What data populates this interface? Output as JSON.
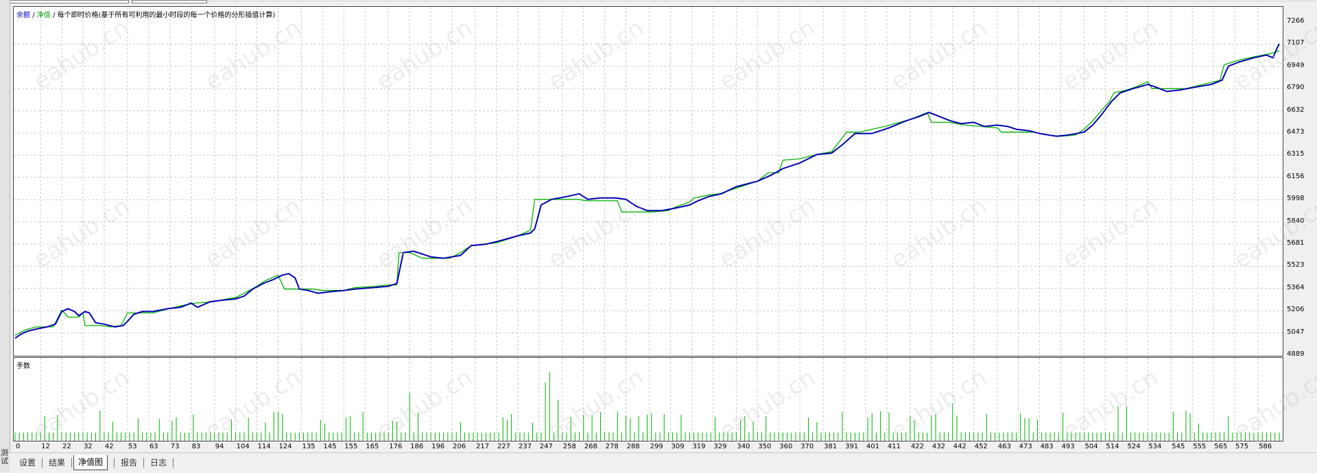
{
  "chart": {
    "legend": {
      "balance": "余额",
      "equity": "净值",
      "sep": "/",
      "note": "每个即时价格(基于所有可利用的最小时段的每一个价格的分形插值计算)"
    },
    "volume_label": "手数",
    "colors": {
      "balance": "#00b000",
      "equity": "#0000b0",
      "volume": "#00b000",
      "grid": "#c8c8c8"
    }
  },
  "sidebar": {
    "label": "测试"
  },
  "tabs": [
    {
      "label": "设置",
      "active": false
    },
    {
      "label": "结果",
      "active": false
    },
    {
      "label": "净值图",
      "active": true
    },
    {
      "label": "报告",
      "active": false
    },
    {
      "label": "日志",
      "active": false
    }
  ],
  "watermark": "eahub.cn",
  "chart_data": {
    "type": "line",
    "y_ticks": [
      "7266",
      "7107",
      "6949",
      "6790",
      "6632",
      "6473",
      "6315",
      "6156",
      "5998",
      "5840",
      "5681",
      "5523",
      "5364",
      "5206",
      "5047",
      "4889"
    ],
    "x_ticks": [
      "0",
      "12",
      "22",
      "32",
      "42",
      "53",
      "63",
      "73",
      "83",
      "94",
      "104",
      "114",
      "124",
      "135",
      "145",
      "155",
      "165",
      "176",
      "186",
      "196",
      "206",
      "217",
      "227",
      "237",
      "247",
      "258",
      "268",
      "278",
      "288",
      "299",
      "309",
      "319",
      "329",
      "340",
      "350",
      "360",
      "370",
      "381",
      "391",
      "401",
      "411",
      "422",
      "432",
      "442",
      "452",
      "463",
      "473",
      "483",
      "493",
      "504",
      "514",
      "524",
      "534",
      "545",
      "555",
      "565",
      "575",
      "586"
    ],
    "ylim": [
      4889,
      7266
    ],
    "xlim": [
      0,
      596
    ],
    "series": [
      {
        "name": "余额",
        "points": [
          [
            0,
            5030
          ],
          [
            5,
            5070
          ],
          [
            10,
            5090
          ],
          [
            18,
            5090
          ],
          [
            22,
            5210
          ],
          [
            25,
            5160
          ],
          [
            30,
            5160
          ],
          [
            32,
            5190
          ],
          [
            33,
            5100
          ],
          [
            40,
            5100
          ],
          [
            45,
            5090
          ],
          [
            50,
            5100
          ],
          [
            53,
            5190
          ],
          [
            57,
            5190
          ],
          [
            65,
            5190
          ],
          [
            70,
            5210
          ],
          [
            78,
            5240
          ],
          [
            85,
            5260
          ],
          [
            94,
            5270
          ],
          [
            100,
            5290
          ],
          [
            104,
            5300
          ],
          [
            108,
            5330
          ],
          [
            114,
            5380
          ],
          [
            118,
            5420
          ],
          [
            124,
            5460
          ],
          [
            127,
            5360
          ],
          [
            135,
            5360
          ],
          [
            140,
            5360
          ],
          [
            145,
            5350
          ],
          [
            155,
            5350
          ],
          [
            160,
            5370
          ],
          [
            170,
            5380
          ],
          [
            176,
            5390
          ],
          [
            180,
            5390
          ],
          [
            181,
            5620
          ],
          [
            186,
            5620
          ],
          [
            192,
            5580
          ],
          [
            205,
            5580
          ],
          [
            210,
            5620
          ],
          [
            215,
            5670
          ],
          [
            220,
            5680
          ],
          [
            227,
            5690
          ],
          [
            237,
            5740
          ],
          [
            243,
            5780
          ],
          [
            245,
            6000
          ],
          [
            252,
            6000
          ],
          [
            260,
            6000
          ],
          [
            265,
            6000
          ],
          [
            270,
            5990
          ],
          [
            278,
            5990
          ],
          [
            284,
            5990
          ],
          [
            286,
            5910
          ],
          [
            290,
            5910
          ],
          [
            300,
            5910
          ],
          [
            308,
            5920
          ],
          [
            312,
            5950
          ],
          [
            318,
            5980
          ],
          [
            320,
            6010
          ],
          [
            327,
            6030
          ],
          [
            332,
            6040
          ],
          [
            340,
            6080
          ],
          [
            350,
            6130
          ],
          [
            355,
            6190
          ],
          [
            360,
            6190
          ],
          [
            362,
            6280
          ],
          [
            370,
            6290
          ],
          [
            378,
            6320
          ],
          [
            385,
            6340
          ],
          [
            389,
            6420
          ],
          [
            392,
            6480
          ],
          [
            398,
            6480
          ],
          [
            410,
            6520
          ],
          [
            422,
            6570
          ],
          [
            430,
            6620
          ],
          [
            432,
            6550
          ],
          [
            440,
            6550
          ],
          [
            448,
            6530
          ],
          [
            463,
            6510
          ],
          [
            465,
            6480
          ],
          [
            475,
            6480
          ],
          [
            480,
            6480
          ],
          [
            487,
            6460
          ],
          [
            493,
            6450
          ],
          [
            500,
            6460
          ],
          [
            504,
            6500
          ],
          [
            508,
            6560
          ],
          [
            512,
            6630
          ],
          [
            516,
            6700
          ],
          [
            518,
            6760
          ],
          [
            524,
            6780
          ],
          [
            528,
            6800
          ],
          [
            534,
            6840
          ],
          [
            536,
            6790
          ],
          [
            545,
            6790
          ],
          [
            552,
            6790
          ],
          [
            560,
            6820
          ],
          [
            568,
            6850
          ],
          [
            570,
            6960
          ],
          [
            576,
            6990
          ],
          [
            585,
            7020
          ],
          [
            592,
            7040
          ],
          [
            596,
            7060
          ]
        ]
      },
      {
        "name": "净值",
        "points": [
          [
            0,
            5010
          ],
          [
            3,
            5040
          ],
          [
            6,
            5060
          ],
          [
            10,
            5075
          ],
          [
            15,
            5090
          ],
          [
            19,
            5110
          ],
          [
            22,
            5200
          ],
          [
            25,
            5220
          ],
          [
            28,
            5200
          ],
          [
            30,
            5170
          ],
          [
            33,
            5200
          ],
          [
            35,
            5190
          ],
          [
            38,
            5120
          ],
          [
            42,
            5110
          ],
          [
            47,
            5090
          ],
          [
            51,
            5100
          ],
          [
            53,
            5130
          ],
          [
            56,
            5180
          ],
          [
            60,
            5200
          ],
          [
            65,
            5200
          ],
          [
            72,
            5220
          ],
          [
            78,
            5230
          ],
          [
            83,
            5260
          ],
          [
            86,
            5230
          ],
          [
            92,
            5270
          ],
          [
            97,
            5280
          ],
          [
            104,
            5290
          ],
          [
            108,
            5310
          ],
          [
            112,
            5360
          ],
          [
            117,
            5400
          ],
          [
            122,
            5430
          ],
          [
            126,
            5460
          ],
          [
            129,
            5470
          ],
          [
            132,
            5440
          ],
          [
            134,
            5360
          ],
          [
            138,
            5350
          ],
          [
            143,
            5330
          ],
          [
            148,
            5340
          ],
          [
            155,
            5350
          ],
          [
            160,
            5360
          ],
          [
            168,
            5370
          ],
          [
            176,
            5380
          ],
          [
            180,
            5400
          ],
          [
            183,
            5620
          ],
          [
            188,
            5630
          ],
          [
            192,
            5610
          ],
          [
            196,
            5590
          ],
          [
            202,
            5580
          ],
          [
            210,
            5600
          ],
          [
            215,
            5670
          ],
          [
            222,
            5680
          ],
          [
            230,
            5710
          ],
          [
            237,
            5740
          ],
          [
            243,
            5760
          ],
          [
            245,
            5790
          ],
          [
            248,
            5960
          ],
          [
            253,
            6000
          ],
          [
            260,
            6020
          ],
          [
            266,
            6040
          ],
          [
            270,
            6000
          ],
          [
            276,
            6010
          ],
          [
            283,
            6010
          ],
          [
            288,
            6000
          ],
          [
            293,
            5950
          ],
          [
            298,
            5920
          ],
          [
            305,
            5920
          ],
          [
            312,
            5940
          ],
          [
            318,
            5960
          ],
          [
            322,
            5990
          ],
          [
            327,
            6020
          ],
          [
            333,
            6040
          ],
          [
            340,
            6090
          ],
          [
            350,
            6130
          ],
          [
            356,
            6170
          ],
          [
            362,
            6220
          ],
          [
            370,
            6260
          ],
          [
            378,
            6320
          ],
          [
            385,
            6330
          ],
          [
            390,
            6390
          ],
          [
            396,
            6470
          ],
          [
            404,
            6470
          ],
          [
            412,
            6510
          ],
          [
            420,
            6560
          ],
          [
            426,
            6590
          ],
          [
            431,
            6620
          ],
          [
            436,
            6590
          ],
          [
            441,
            6560
          ],
          [
            446,
            6540
          ],
          [
            452,
            6550
          ],
          [
            457,
            6520
          ],
          [
            463,
            6530
          ],
          [
            468,
            6520
          ],
          [
            472,
            6500
          ],
          [
            478,
            6490
          ],
          [
            483,
            6470
          ],
          [
            487,
            6460
          ],
          [
            491,
            6450
          ],
          [
            497,
            6460
          ],
          [
            504,
            6480
          ],
          [
            508,
            6530
          ],
          [
            512,
            6600
          ],
          [
            517,
            6700
          ],
          [
            521,
            6760
          ],
          [
            527,
            6790
          ],
          [
            534,
            6820
          ],
          [
            538,
            6800
          ],
          [
            543,
            6770
          ],
          [
            549,
            6780
          ],
          [
            556,
            6800
          ],
          [
            564,
            6820
          ],
          [
            569,
            6850
          ],
          [
            572,
            6950
          ],
          [
            577,
            6980
          ],
          [
            584,
            7010
          ],
          [
            590,
            7030
          ],
          [
            593,
            7010
          ],
          [
            595,
            7080
          ],
          [
            596,
            7110
          ]
        ]
      }
    ]
  }
}
